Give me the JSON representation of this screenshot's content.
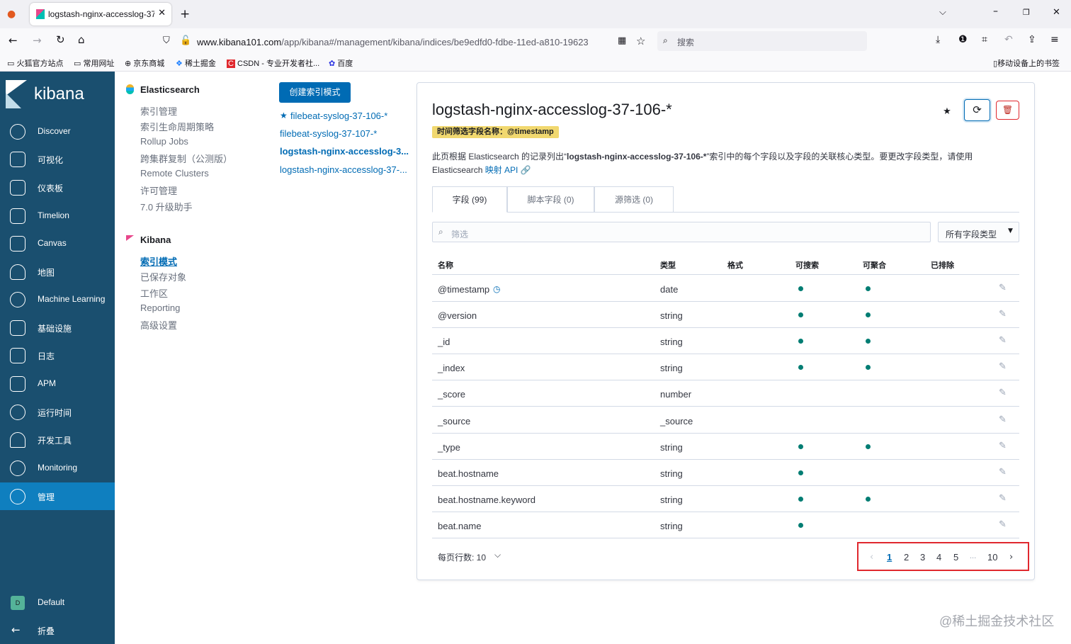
{
  "browser": {
    "tab_title": "logstash-nginx-accesslog-37",
    "url_domain": "www.kibana101.com",
    "url_path": "/app/kibana#/management/kibana/indices/be9edfd0-fdbe-11ed-a810-19623",
    "search_placeholder": "搜索",
    "bookmarks": [
      "火狐官方站点",
      "常用网址",
      "京东商城",
      "稀土掘金",
      "CSDN - 专业开发者社...",
      "百度"
    ],
    "mobile_bookmarks": "移动设备上的书签"
  },
  "sidebar": {
    "brand": "kibana",
    "items": [
      {
        "label": "Discover",
        "icon": "compass-icon"
      },
      {
        "label": "可视化",
        "icon": "visualize-icon"
      },
      {
        "label": "仪表板",
        "icon": "dashboard-icon"
      },
      {
        "label": "Timelion",
        "icon": "timelion-icon"
      },
      {
        "label": "Canvas",
        "icon": "canvas-icon"
      },
      {
        "label": "地图",
        "icon": "map-icon"
      },
      {
        "label": "Machine Learning",
        "icon": "ml-icon"
      },
      {
        "label": "基础设施",
        "icon": "infra-icon"
      },
      {
        "label": "日志",
        "icon": "logs-icon"
      },
      {
        "label": "APM",
        "icon": "apm-icon"
      },
      {
        "label": "运行时间",
        "icon": "uptime-icon"
      },
      {
        "label": "开发工具",
        "icon": "devtools-icon"
      },
      {
        "label": "Monitoring",
        "icon": "monitoring-icon"
      },
      {
        "label": "管理",
        "icon": "gear-icon"
      }
    ],
    "space_badge": "D",
    "space_label": "Default",
    "collapse_label": "折叠"
  },
  "management_nav": {
    "elasticsearch_title": "Elasticsearch",
    "elasticsearch_items": [
      "索引管理",
      "索引生命周期策略",
      "Rollup Jobs",
      "跨集群复制（公测版）",
      "Remote Clusters",
      "许可管理",
      "7.0 升级助手"
    ],
    "kibana_title": "Kibana",
    "kibana_items": [
      "索引模式",
      "已保存对象",
      "工作区",
      "Reporting",
      "高级设置"
    ]
  },
  "index_patterns": {
    "create_button": "创建索引模式",
    "items": [
      "filebeat-syslog-37-106-*",
      "filebeat-syslog-37-107-*",
      "logstash-nginx-accesslog-3...",
      "logstash-nginx-accesslog-37-..."
    ]
  },
  "main": {
    "title": "logstash-nginx-accesslog-37-106-*",
    "time_field_badge": "时间筛选字段名称：@timestamp",
    "desc_prefix": "此页根据 Elasticsearch 的记录列出“",
    "desc_index": "logstash-nginx-accesslog-37-106-*",
    "desc_suffix": "”索引中的每个字段以及字段的关联核心类型。要更改字段类型，请使用",
    "desc_line2": "Elasticsearch ",
    "desc_link": "映射 API",
    "tabs": [
      "字段 (99)",
      "脚本字段 (0)",
      "源筛选 (0)"
    ],
    "filter_placeholder": "筛选",
    "type_filter": "所有字段类型",
    "columns": [
      "名称",
      "类型",
      "格式",
      "可搜索",
      "可聚合",
      "已排除"
    ],
    "rows": [
      {
        "name": "@timestamp",
        "type": "date",
        "searchable": true,
        "aggregatable": true
      },
      {
        "name": "@version",
        "type": "string",
        "searchable": true,
        "aggregatable": true
      },
      {
        "name": "_id",
        "type": "string",
        "searchable": true,
        "aggregatable": true
      },
      {
        "name": "_index",
        "type": "string",
        "searchable": true,
        "aggregatable": true
      },
      {
        "name": "_score",
        "type": "number",
        "searchable": false,
        "aggregatable": false
      },
      {
        "name": "_source",
        "type": "_source",
        "searchable": false,
        "aggregatable": false
      },
      {
        "name": "_type",
        "type": "string",
        "searchable": true,
        "aggregatable": true
      },
      {
        "name": "beat.hostname",
        "type": "string",
        "searchable": true,
        "aggregatable": false
      },
      {
        "name": "beat.hostname.keyword",
        "type": "string",
        "searchable": true,
        "aggregatable": true
      },
      {
        "name": "beat.name",
        "type": "string",
        "searchable": true,
        "aggregatable": false
      }
    ],
    "rows_per_page": "每页行数: 10",
    "pagination": [
      "1",
      "2",
      "3",
      "4",
      "5",
      "...",
      "10"
    ],
    "current_page": "1"
  },
  "watermark": "@稀土掘金技术社区",
  "colors": {
    "sidebar": "#1a4f6f",
    "active": "#0f7fbf",
    "link": "#006bb4",
    "dot": "#017d73",
    "badge": "#f1d86f",
    "highlight": "#e0282e"
  }
}
